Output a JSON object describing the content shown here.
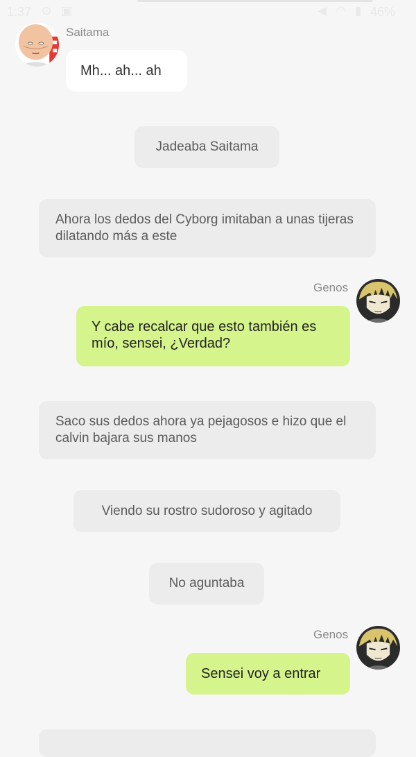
{
  "status": {
    "time": "1:37",
    "battery": "46%"
  },
  "messages": [
    {
      "sender": "Saitama",
      "text": "Mh... ah... ah"
    },
    {
      "narration": "Jadeaba Saitama"
    },
    {
      "narration": "Ahora los dedos del Cyborg imitaban a unas tijeras dilatando más a este"
    },
    {
      "sender": "Genos",
      "text": "Y cabe recalcar que esto también es mío, sensei, ¿Verdad?"
    },
    {
      "narration": "Saco sus dedos ahora ya pejagosos e hizo que el calvin bajara sus manos"
    },
    {
      "narration": "Viendo su rostro sudoroso y agitado"
    },
    {
      "narration": "No aguntaba"
    },
    {
      "sender": "Genos",
      "text": "Sensei voy a entrar"
    }
  ]
}
